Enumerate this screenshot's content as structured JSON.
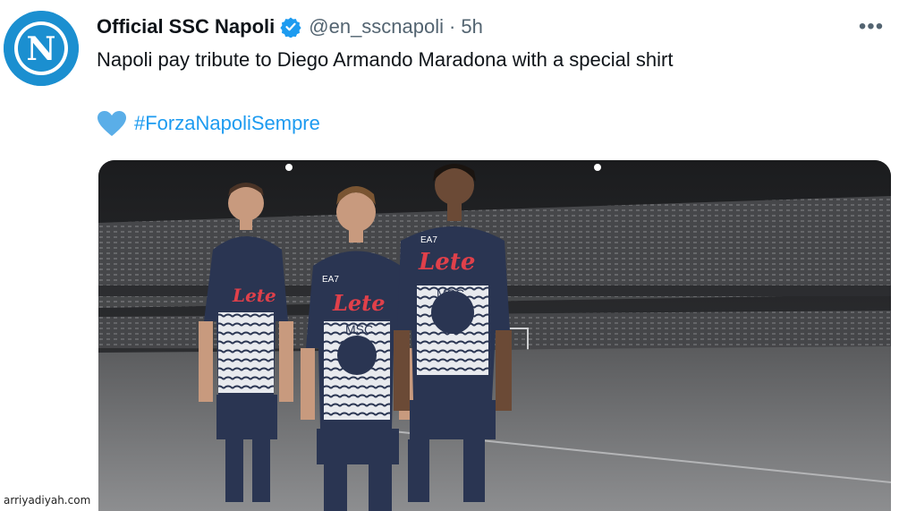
{
  "tweet": {
    "display_name": "Official SSC Napoli",
    "handle": "@en_sscnapoli",
    "separator": "·",
    "timestamp": "5h",
    "more_label": "•••",
    "text": "Napoli pay tribute to Diego Armando Maradona with a special shirt",
    "hashtag": "#ForzaNapoliSempre",
    "avatar_letter": "N",
    "verified": true
  },
  "media": {
    "shirt_sponsor": "Lete",
    "shirt_text": "MSC",
    "kit_brand": "EA7"
  },
  "watermark": "arriyadiyah.com",
  "colors": {
    "brand_blue": "#1b8fd0",
    "link": "#1d9bf0",
    "verified": "#1d9bf0",
    "secondary_text": "#536471",
    "heart": "#5aaee8",
    "kit_navy": "#2a3552"
  },
  "icons": {
    "verified": "verified-badge-icon",
    "heart": "blue-heart-icon",
    "more": "more-options-icon"
  }
}
